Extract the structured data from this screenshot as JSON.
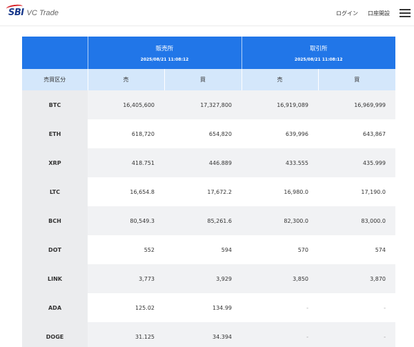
{
  "header": {
    "logo_mark": "SBI",
    "logo_text": "VC Trade",
    "login_label": "ログイン",
    "open_account_label": "口座開設"
  },
  "table": {
    "groups": [
      {
        "label": "販売所",
        "timestamp": "2025/08/21 11:08:12"
      },
      {
        "label": "取引所",
        "timestamp": "2025/08/21 11:08:12"
      }
    ],
    "row_header": "売買区分",
    "sub_headers": [
      "売",
      "買",
      "売",
      "買"
    ],
    "rows": [
      {
        "coin": "BTC",
        "values": [
          "16,405,600",
          "17,327,800",
          "16,919,089",
          "16,969,999"
        ]
      },
      {
        "coin": "ETH",
        "values": [
          "618,720",
          "654,820",
          "639,996",
          "643,867"
        ]
      },
      {
        "coin": "XRP",
        "values": [
          "418.751",
          "446.889",
          "433.555",
          "435.999"
        ]
      },
      {
        "coin": "LTC",
        "values": [
          "16,654.8",
          "17,672.2",
          "16,980.0",
          "17,190.0"
        ]
      },
      {
        "coin": "BCH",
        "values": [
          "80,549.3",
          "85,261.6",
          "82,300.0",
          "83,000.0"
        ]
      },
      {
        "coin": "DOT",
        "values": [
          "552",
          "594",
          "570",
          "574"
        ]
      },
      {
        "coin": "LINK",
        "values": [
          "3,773",
          "3,929",
          "3,850",
          "3,870"
        ]
      },
      {
        "coin": "ADA",
        "values": [
          "125.02",
          "134.99",
          "-",
          "-"
        ]
      },
      {
        "coin": "DOGE",
        "values": [
          "31.125",
          "34.394",
          "-",
          "-"
        ]
      }
    ]
  },
  "colors": {
    "header_blue": "#2176e8",
    "subheader_blue": "#d4e7fb"
  }
}
